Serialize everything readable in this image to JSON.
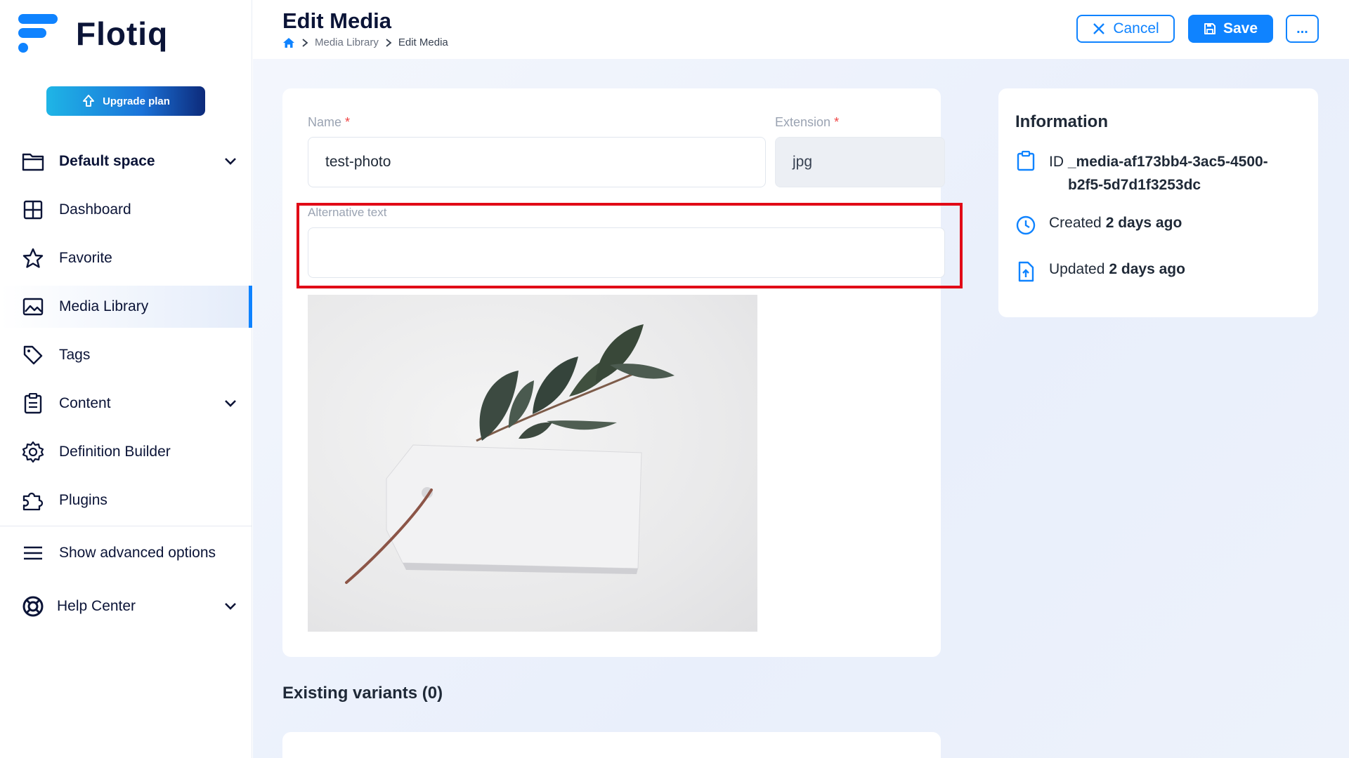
{
  "brand": {
    "name": "Flotiq",
    "accent": "#0f83ff"
  },
  "sidebar": {
    "upgrade_label": "Upgrade plan",
    "items": [
      {
        "label": "Default space",
        "icon": "folder-icon",
        "bold": true,
        "chevron": true
      },
      {
        "label": "Dashboard",
        "icon": "dashboard-grid-icon"
      },
      {
        "label": "Favorite",
        "icon": "star-icon"
      },
      {
        "label": "Media Library",
        "icon": "image-icon",
        "active": true
      },
      {
        "label": "Tags",
        "icon": "tag-icon"
      },
      {
        "label": "Content",
        "icon": "clipboard-icon",
        "chevron": true
      },
      {
        "label": "Definition Builder",
        "icon": "gear-icon"
      },
      {
        "label": "Plugins",
        "icon": "puzzle-icon"
      }
    ],
    "advanced_label": "Show advanced options",
    "help_label": "Help Center"
  },
  "header": {
    "title": "Edit Media",
    "breadcrumb": [
      "Media Library",
      "Edit Media"
    ],
    "cancel_label": "Cancel",
    "save_label": "Save",
    "more_label": "..."
  },
  "form": {
    "name_label": "Name",
    "name_value": "test-photo",
    "extension_label": "Extension",
    "extension_value": "jpg",
    "required_mark": "*",
    "alt_label": "Alternative text",
    "alt_value": ""
  },
  "variants": {
    "title": "Existing variants (0)"
  },
  "info": {
    "title": "Information",
    "id_label": "ID",
    "id_value": "_media-af173bb4-3ac5-4500-",
    "id_value_2": "b2f5-5d7d1f3253dc",
    "created_label": "Created",
    "created_value": "2 days ago",
    "updated_label": "Updated",
    "updated_value": "2 days ago"
  }
}
